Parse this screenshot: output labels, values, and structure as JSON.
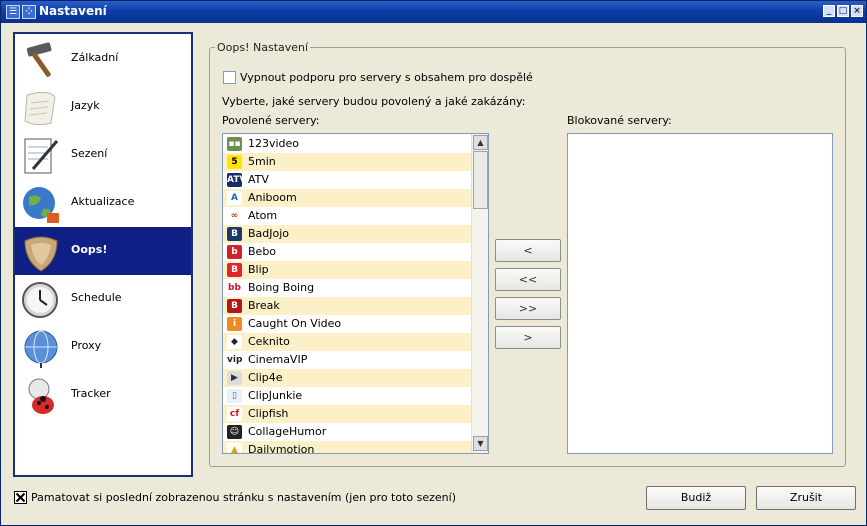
{
  "window": {
    "title": "Nastavení"
  },
  "sidebar": {
    "items": [
      {
        "label": "Zálkadní",
        "icon": "hammer-icon",
        "active": false
      },
      {
        "label": "Jazyk",
        "icon": "scroll-icon",
        "active": false
      },
      {
        "label": "Sezení",
        "icon": "notepad-pen-icon",
        "active": false
      },
      {
        "label": "Aktualizace",
        "icon": "globe-update-icon",
        "active": false
      },
      {
        "label": "Oops!",
        "icon": "oops-shield-icon",
        "active": true
      },
      {
        "label": "Schedule",
        "icon": "clock-icon",
        "active": false
      },
      {
        "label": "Proxy",
        "icon": "network-globe-icon",
        "active": false
      },
      {
        "label": "Tracker",
        "icon": "ladybug-icon",
        "active": false
      }
    ]
  },
  "oops": {
    "group_title": "Oops! Nastavení",
    "adult_checkbox_label": "Vypnout podporu pro servery s obsahem pro dospělé",
    "adult_checked": false,
    "instruction": "Vyberte, jaké servery budou povolený a jaké zakázány:",
    "allowed_label": "Povolené servery:",
    "blocked_label": "Blokované servery:",
    "allowed_servers": [
      {
        "name": "123video",
        "icon": "123video-icon",
        "badge": "▪▪",
        "color": "#6b8f4e",
        "text": "#fff"
      },
      {
        "name": "5min",
        "icon": "5min-icon",
        "badge": "5",
        "color": "#ffe400",
        "text": "#000"
      },
      {
        "name": "ATV",
        "icon": "atv-icon",
        "badge": "ATV",
        "color": "#1a2b6b",
        "text": "#fff"
      },
      {
        "name": "Aniboom",
        "icon": "aniboom-icon",
        "badge": "A",
        "color": "#ffffff",
        "text": "#1769c2"
      },
      {
        "name": "Atom",
        "icon": "atom-icon",
        "badge": "∞",
        "color": "#ffffff",
        "text": "#b5441c"
      },
      {
        "name": "BadJojo",
        "icon": "badjojo-icon",
        "badge": "B",
        "color": "#1d3a66",
        "text": "#fff"
      },
      {
        "name": "Bebo",
        "icon": "bebo-icon",
        "badge": "b",
        "color": "#d2232a",
        "text": "#fff"
      },
      {
        "name": "Blip",
        "icon": "blip-icon",
        "badge": "B",
        "color": "#e0262b",
        "text": "#fff"
      },
      {
        "name": "Boing Boing",
        "icon": "boingboing-icon",
        "badge": "bb",
        "color": "#ffffff",
        "text": "#c8102e"
      },
      {
        "name": "Break",
        "icon": "break-icon",
        "badge": "B",
        "color": "#b4161b",
        "text": "#fff"
      },
      {
        "name": "Caught On Video",
        "icon": "caughtonvideo-icon",
        "badge": "i",
        "color": "#f08a24",
        "text": "#fff"
      },
      {
        "name": "Ceknito",
        "icon": "ceknito-icon",
        "badge": "◆",
        "color": "#ffffff",
        "text": "#222"
      },
      {
        "name": "CinemaVIP",
        "icon": "cinemavip-icon",
        "badge": "vip",
        "color": "#ffffff",
        "text": "#222"
      },
      {
        "name": "Clip4e",
        "icon": "clip4e-icon",
        "badge": "▶",
        "color": "#dcdcdc",
        "text": "#333"
      },
      {
        "name": "ClipJunkie",
        "icon": "clipjunkie-icon",
        "badge": "▯",
        "color": "#e8f0fa",
        "text": "#4a6ea8"
      },
      {
        "name": "Clipfish",
        "icon": "clipfish-icon",
        "badge": "cf",
        "color": "#ffffff",
        "text": "#d0161b"
      },
      {
        "name": "CollageHumor",
        "icon": "collegehumor-icon",
        "badge": "☺",
        "color": "#222222",
        "text": "#fff"
      },
      {
        "name": "Dailymotion",
        "icon": "dailymotion-icon",
        "badge": "▲",
        "color": "#ffffff",
        "text": "#e0a000"
      }
    ],
    "move_buttons": [
      "<",
      "<<",
      ">>",
      ">"
    ]
  },
  "footer": {
    "remember_label": "Pamatovat si poslední zobrazenou stránku s nastavením (jen pro toto sezení)",
    "remember_checked": true,
    "ok_label": "Budiž",
    "cancel_label": "Zrušit"
  }
}
